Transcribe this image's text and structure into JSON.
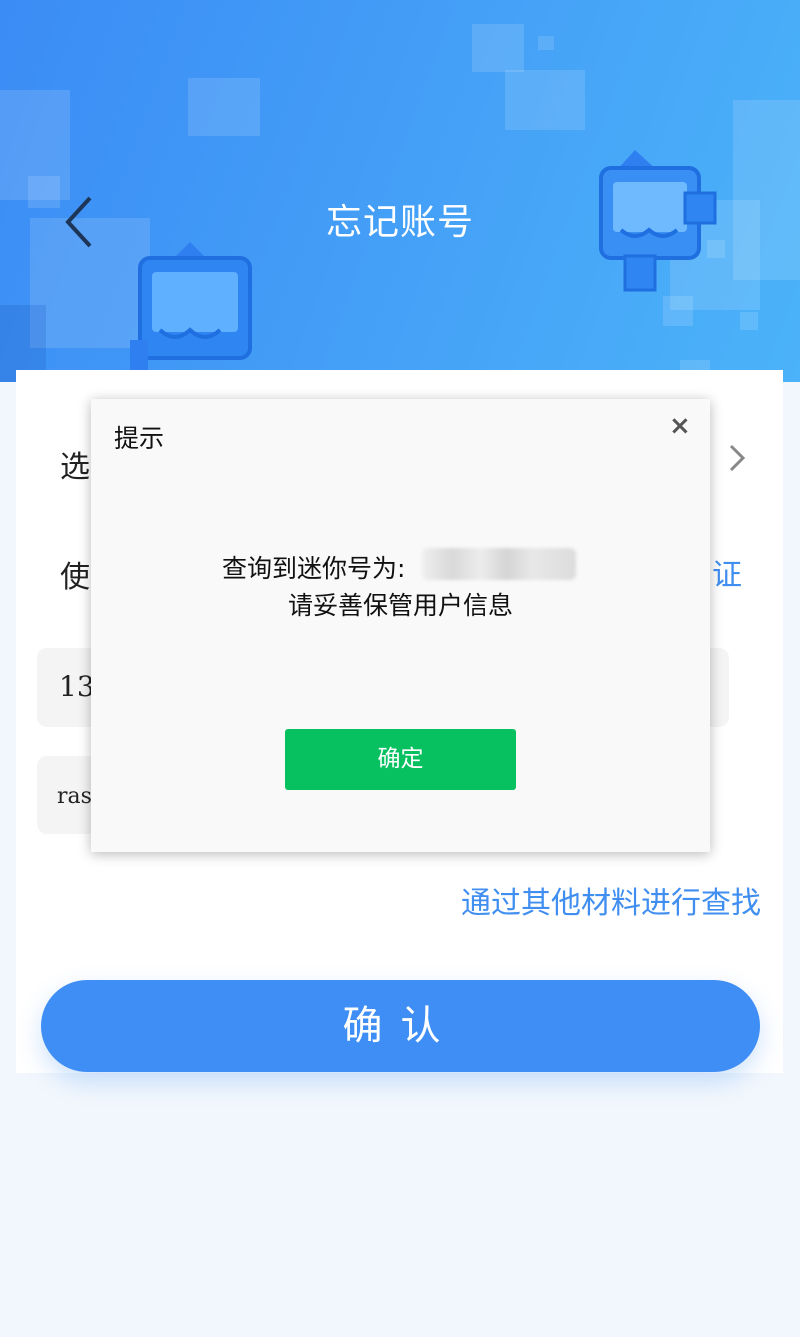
{
  "header": {
    "title": "忘记账号"
  },
  "form": {
    "row1_label": "选",
    "row2_label": "使",
    "row2_link": "证",
    "field1_value": "13",
    "field2_value": "ras",
    "other_link": "通过其他材料进行查找",
    "confirm_label": "确认"
  },
  "dialog": {
    "title": "提示",
    "close": "×",
    "message_line1": "查询到迷你号为:",
    "message_line2": "请妥善保管用户信息",
    "ok_label": "确定"
  },
  "colors": {
    "header_blue": "#3b8cf5",
    "link_blue": "#3f8ef0",
    "ok_green": "#07c160"
  }
}
